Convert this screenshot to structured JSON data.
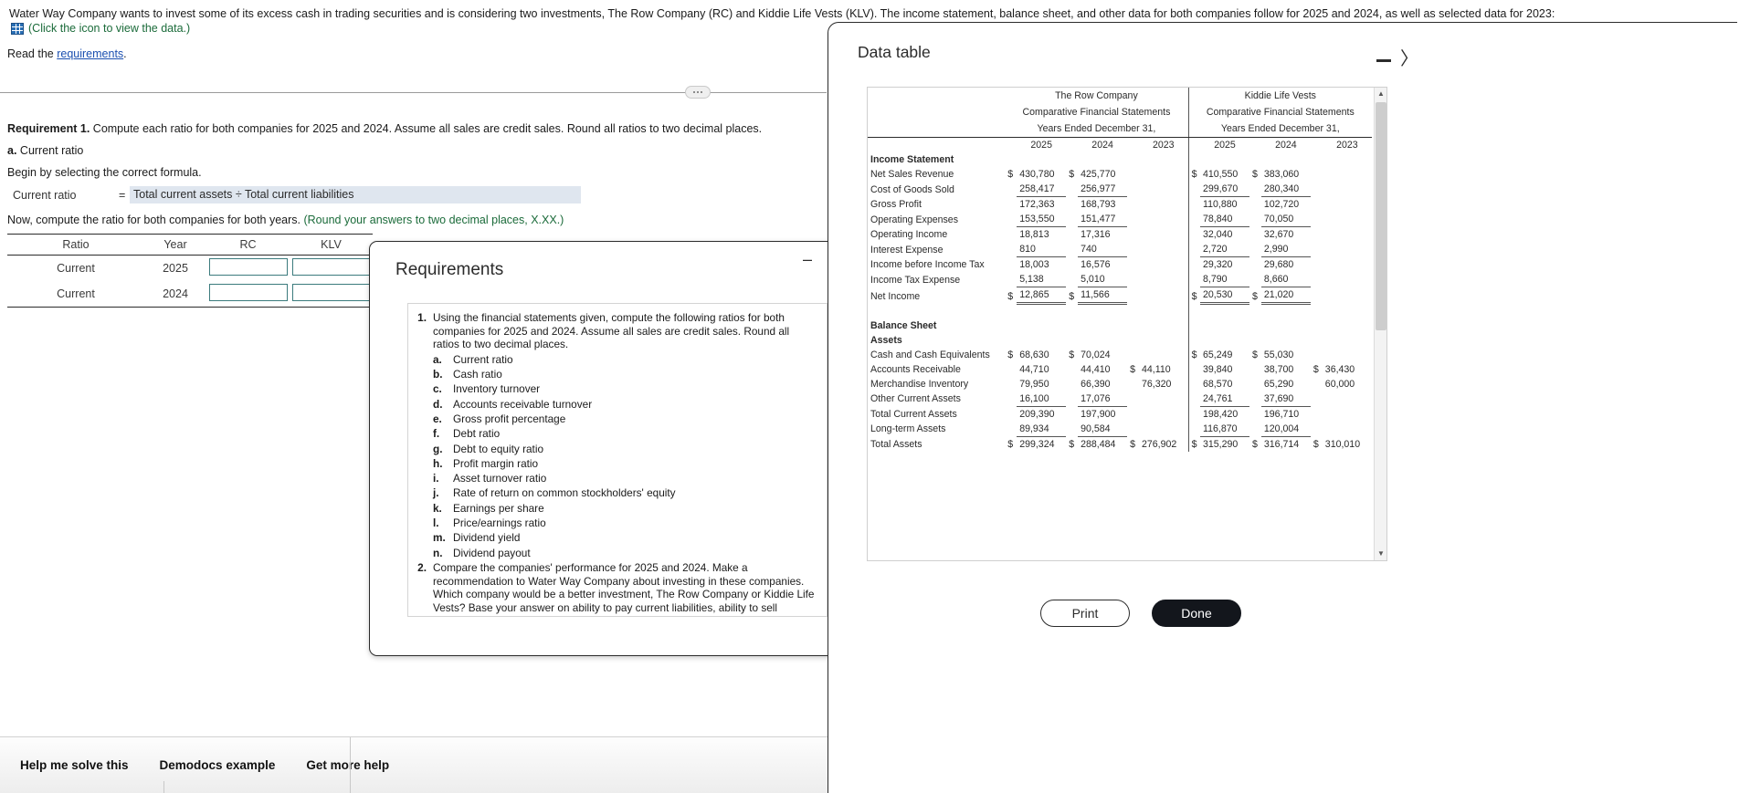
{
  "problem": {
    "statement": "Water Way Company wants to invest some of its excess cash in trading securities and is considering two investments, The Row Company (RC) and Kiddie Life Vests (KLV). The income statement, balance sheet, and other data for both companies follow for 2025 and 2024, as well as selected data for 2023:",
    "data_icon_text": "(Click the icon to view the data.)",
    "read_prefix": "Read the ",
    "read_link": "requirements",
    "read_suffix": ".",
    "requirement_label": "Requirement 1.",
    "requirement_text": " Compute each ratio for both companies for 2025 and 2024. Assume all sales are credit sales. Round all ratios to two decimal places.",
    "part_label": "a.",
    "part_text": " Current ratio",
    "begin_line": "Begin by selecting the correct formula.",
    "formula_label": "Current ratio",
    "formula_equals": "=",
    "formula_value": "Total current assets ÷ Total current liabilities",
    "now_line": "Now, compute the ratio for both companies for both years. ",
    "now_hint": "(Round your answers to two decimal places, X.XX.)"
  },
  "ratio_table": {
    "headers": [
      "Ratio",
      "Year",
      "RC",
      "KLV"
    ],
    "rows": [
      {
        "ratio": "Current",
        "year": "2025",
        "rc": "",
        "klv": ""
      },
      {
        "ratio": "Current",
        "year": "2024",
        "rc": "",
        "klv": ""
      }
    ]
  },
  "help_bar": {
    "items": [
      "Help me solve this",
      "Demodocs example",
      "Get more help"
    ]
  },
  "requirements_dialog": {
    "title": "Requirements",
    "minimize_glyph": "–",
    "close_glyph": "✕",
    "items": [
      {
        "num": "1.",
        "text": "Using the financial statements given, compute the following ratios for both companies for 2025 and 2024. Assume all sales are credit sales. Round all ratios to two decimal places.",
        "sub": [
          {
            "letter": "a.",
            "text": "Current ratio"
          },
          {
            "letter": "b.",
            "text": "Cash ratio"
          },
          {
            "letter": "c.",
            "text": "Inventory turnover"
          },
          {
            "letter": "d.",
            "text": "Accounts receivable turnover"
          },
          {
            "letter": "e.",
            "text": "Gross profit percentage"
          },
          {
            "letter": "f.",
            "text": "Debt ratio"
          },
          {
            "letter": "g.",
            "text": "Debt to equity ratio"
          },
          {
            "letter": "h.",
            "text": "Profit margin ratio"
          },
          {
            "letter": "i.",
            "text": "Asset turnover ratio"
          },
          {
            "letter": "j.",
            "text": "Rate of return on common stockholders' equity"
          },
          {
            "letter": "k.",
            "text": "Earnings per share"
          },
          {
            "letter": "l.",
            "text": "Price/earnings ratio"
          },
          {
            "letter": "m.",
            "text": "Dividend yield"
          },
          {
            "letter": "n.",
            "text": "Dividend payout"
          }
        ]
      },
      {
        "num": "2.",
        "text": "Compare the companies' performance for 2025 and 2024. Make a recommendation to Water Way Company about investing in these companies. Which company would be a better investment, The Row Company or Kiddie Life Vests? Base your answer on ability to pay current liabilities, ability to sell merchandise and collect receivables, ability to pay long-term debt, profitability, and attractiveness as an investment.",
        "sub": []
      }
    ]
  },
  "data_panel": {
    "title": "Data table",
    "minimize_glyph": "",
    "expand_glyph": "〉",
    "print_label": "Print",
    "done_label": "Done",
    "companies": [
      {
        "name": "The Row Company",
        "line2": "Comparative Financial Statements",
        "line3": "Years Ended December 31,",
        "years": [
          "2025",
          "2024",
          "2023"
        ]
      },
      {
        "name": "Kiddie Life Vests",
        "line2": "Comparative Financial Statements",
        "line3": "Years Ended December 31,",
        "years": [
          "2025",
          "2024",
          "2023"
        ]
      }
    ],
    "sections": [
      {
        "heading": "Income Statement",
        "rows": [
          {
            "label": "Net Sales Revenue",
            "rc": [
              "430,780",
              "425,770",
              ""
            ],
            "rc_dollar": true,
            "klv": [
              "410,550",
              "383,060",
              ""
            ],
            "klv_dollar": true,
            "rule": "none"
          },
          {
            "label": "Cost of Goods Sold",
            "rc": [
              "258,417",
              "256,977",
              ""
            ],
            "rc_dollar": false,
            "klv": [
              "299,670",
              "280,340",
              ""
            ],
            "klv_dollar": false,
            "rule": "single"
          },
          {
            "label": "Gross Profit",
            "rc": [
              "172,363",
              "168,793",
              ""
            ],
            "rc_dollar": false,
            "klv": [
              "110,880",
              "102,720",
              ""
            ],
            "klv_dollar": false,
            "rule": "none"
          },
          {
            "label": "Operating Expenses",
            "rc": [
              "153,550",
              "151,477",
              ""
            ],
            "rc_dollar": false,
            "klv": [
              "78,840",
              "70,050",
              ""
            ],
            "klv_dollar": false,
            "rule": "single"
          },
          {
            "label": "Operating Income",
            "rc": [
              "18,813",
              "17,316",
              ""
            ],
            "rc_dollar": false,
            "klv": [
              "32,040",
              "32,670",
              ""
            ],
            "klv_dollar": false,
            "rule": "none"
          },
          {
            "label": "Interest Expense",
            "rc": [
              "810",
              "740",
              ""
            ],
            "rc_dollar": false,
            "klv": [
              "2,720",
              "2,990",
              ""
            ],
            "klv_dollar": false,
            "rule": "single"
          },
          {
            "label": "Income before Income Tax",
            "rc": [
              "18,003",
              "16,576",
              ""
            ],
            "rc_dollar": false,
            "klv": [
              "29,320",
              "29,680",
              ""
            ],
            "klv_dollar": false,
            "rule": "none"
          },
          {
            "label": "Income Tax Expense",
            "rc": [
              "5,138",
              "5,010",
              ""
            ],
            "rc_dollar": false,
            "klv": [
              "8,790",
              "8,660",
              ""
            ],
            "klv_dollar": false,
            "rule": "single"
          },
          {
            "label": "Net Income",
            "rc": [
              "12,865",
              "11,566",
              ""
            ],
            "rc_dollar": true,
            "klv": [
              "20,530",
              "21,020",
              ""
            ],
            "klv_dollar": true,
            "rule": "double"
          }
        ]
      },
      {
        "heading": "Balance Sheet",
        "subheading": "Assets",
        "rows": [
          {
            "label": "Cash and Cash Equivalents",
            "rc": [
              "68,630",
              "70,024",
              ""
            ],
            "rc_dollar": true,
            "klv": [
              "65,249",
              "55,030",
              ""
            ],
            "klv_dollar": true,
            "rule": "none"
          },
          {
            "label": "Accounts Receivable",
            "rc": [
              "44,710",
              "44,410",
              "44,110"
            ],
            "rc_dollar": false,
            "klv": [
              "39,840",
              "38,700",
              "36,430"
            ],
            "klv_dollar": false,
            "rule": "none",
            "third_dollar": true
          },
          {
            "label": "Merchandise Inventory",
            "rc": [
              "79,950",
              "66,390",
              "76,320"
            ],
            "rc_dollar": false,
            "klv": [
              "68,570",
              "65,290",
              "60,000"
            ],
            "klv_dollar": false,
            "rule": "none"
          },
          {
            "label": "Other Current Assets",
            "rc": [
              "16,100",
              "17,076",
              ""
            ],
            "rc_dollar": false,
            "klv": [
              "24,761",
              "37,690",
              ""
            ],
            "klv_dollar": false,
            "rule": "single"
          },
          {
            "label": "Total Current Assets",
            "rc": [
              "209,390",
              "197,900",
              ""
            ],
            "rc_dollar": false,
            "klv": [
              "198,420",
              "196,710",
              ""
            ],
            "klv_dollar": false,
            "rule": "none"
          },
          {
            "label": "Long-term Assets",
            "rc": [
              "89,934",
              "90,584",
              ""
            ],
            "rc_dollar": false,
            "klv": [
              "116,870",
              "120,004",
              ""
            ],
            "klv_dollar": false,
            "rule": "single"
          },
          {
            "label": "Total Assets",
            "rc": [
              "299,324",
              "288,484",
              "276,902"
            ],
            "rc_dollar": true,
            "klv": [
              "315,290",
              "316,714",
              "310,010"
            ],
            "klv_dollar": true,
            "rule": "none",
            "third_dollar": true
          }
        ]
      }
    ]
  }
}
